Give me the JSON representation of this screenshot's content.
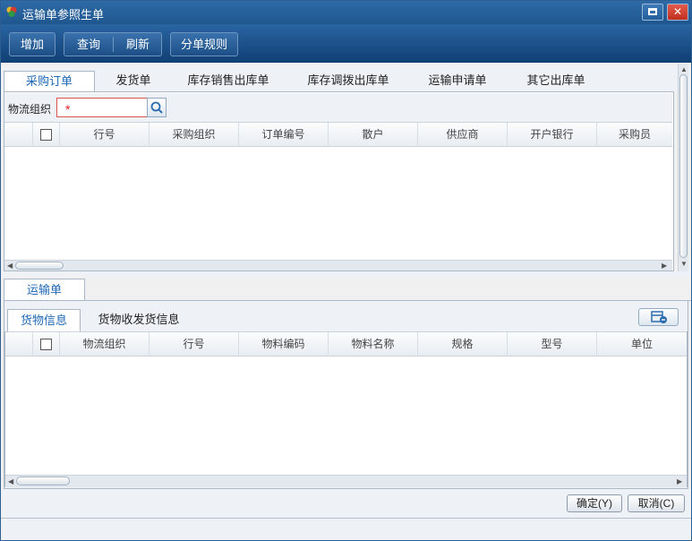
{
  "window": {
    "title": "运输单参照生单"
  },
  "toolbar": {
    "add_label": "增加",
    "query_label": "查询",
    "refresh_label": "刷新",
    "split_rule_label": "分单规则"
  },
  "upper_tabs": [
    "采购订单",
    "发货单",
    "库存销售出库单",
    "库存调拨出库单",
    "运输申请单",
    "其它出库单"
  ],
  "filter": {
    "label": "物流组织",
    "required_mark": "*"
  },
  "upper_grid": {
    "columns": [
      "行号",
      "采购组织",
      "订单编号",
      "散户",
      "供应商",
      "开户银行",
      "采购员"
    ]
  },
  "lower_tab": "运输单",
  "lower_subtabs": [
    "货物信息",
    "货物收发货信息"
  ],
  "lower_grid": {
    "columns": [
      "物流组织",
      "行号",
      "物料编码",
      "物料名称",
      "规格",
      "型号",
      "单位"
    ]
  },
  "footer": {
    "ok_label": "确定(Y)",
    "cancel_label": "取消(C)"
  },
  "colors": {
    "titlebar": "#1f5790",
    "accent": "#1d67b5",
    "required": "#e02020"
  }
}
